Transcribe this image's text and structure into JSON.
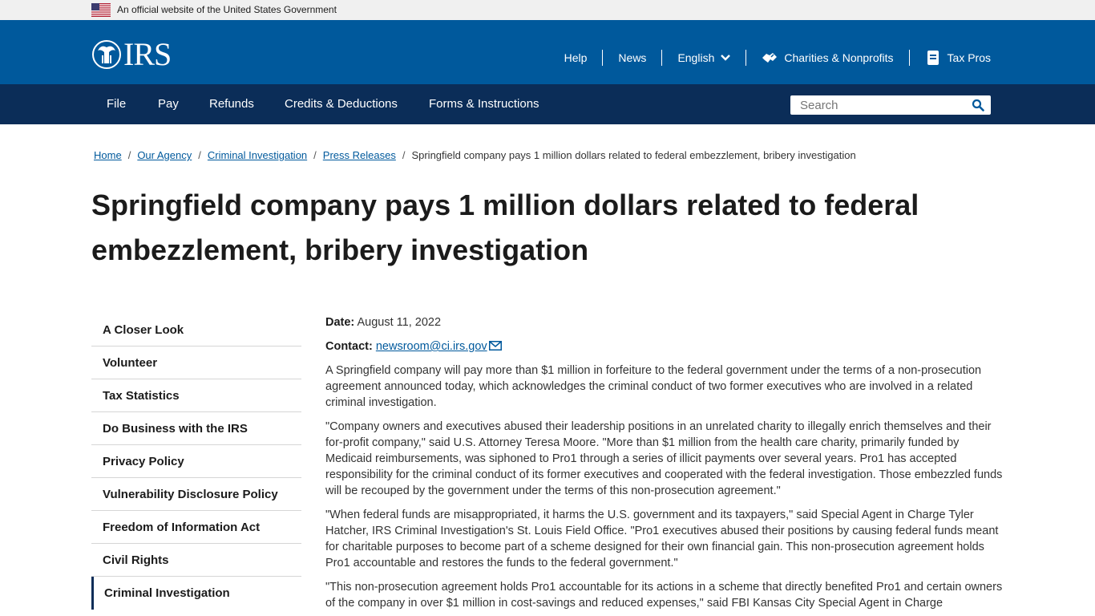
{
  "gov_banner": {
    "text": "An official website of the United States Government"
  },
  "header": {
    "logo_text": "IRS",
    "util_nav": {
      "help": "Help",
      "news": "News",
      "language": "English",
      "charities": "Charities & Nonprofits",
      "tax_pros": "Tax Pros"
    }
  },
  "main_nav": {
    "items": [
      "File",
      "Pay",
      "Refunds",
      "Credits & Deductions",
      "Forms & Instructions"
    ],
    "search_placeholder": "Search"
  },
  "breadcrumb": {
    "items": [
      "Home",
      "Our Agency",
      "Criminal Investigation",
      "Press Releases"
    ],
    "current": "Springfield company pays 1 million dollars related to federal embezzlement, bribery investigation",
    "separator": "/"
  },
  "page_title": "Springfield company pays 1 million dollars related to federal embezzlement, bribery investigation",
  "sidebar": {
    "items": [
      "A Closer Look",
      "Volunteer",
      "Tax Statistics",
      "Do Business with the IRS",
      "Privacy Policy",
      "Vulnerability Disclosure Policy",
      "Freedom of Information Act",
      "Civil Rights",
      "Criminal Investigation"
    ]
  },
  "article": {
    "date_label": "Date:",
    "date": "August 11, 2022",
    "contact_label": "Contact:",
    "contact_email": "newsroom@ci.irs.gov",
    "paragraphs": [
      "A Springfield company will pay more than $1 million in forfeiture to the federal government under the terms of a non-prosecution agreement announced today, which acknowledges the criminal conduct of two former executives who are involved in a related criminal investigation.",
      "\"Company owners and executives abused their leadership positions in an unrelated charity to illegally enrich themselves and their for-profit company,\" said U.S. Attorney Teresa Moore. \"More than $1 million from the health care charity, primarily funded by Medicaid reimbursements, was siphoned to Pro1 through a series of illicit payments over several years. Pro1 has accepted responsibility for the criminal conduct of its former executives and cooperated with the federal investigation. Those embezzled funds will be recouped by the government under the terms of this non-prosecution agreement.\"",
      "\"When federal funds are misappropriated, it harms the U.S. government and its taxpayers,\" said Special Agent in Charge Tyler Hatcher, IRS Criminal Investigation's St. Louis Field Office. \"Pro1 executives abused their positions by causing federal funds meant for charitable purposes to become part of a scheme designed for their own financial gain. This non-prosecution agreement holds Pro1 accountable and restores the funds to the federal government.\"",
      "\"This non-prosecution agreement holds Pro1 accountable for its actions in a scheme that directly benefited Pro1 and certain owners of the company in over $1 million in cost-savings and reduced expenses,\" said FBI Kansas City Special Agent in Charge"
    ]
  },
  "colors": {
    "header_blue": "#00599c",
    "nav_navy": "#0b2d58",
    "link_blue": "#00599c",
    "banner_gray": "#f0f0f0"
  },
  "icons": [
    "us-flag-icon",
    "irs-eagle-logo-icon",
    "chevron-down-icon",
    "handshake-icon",
    "tax-pros-icon",
    "search-icon",
    "mail-icon"
  ]
}
